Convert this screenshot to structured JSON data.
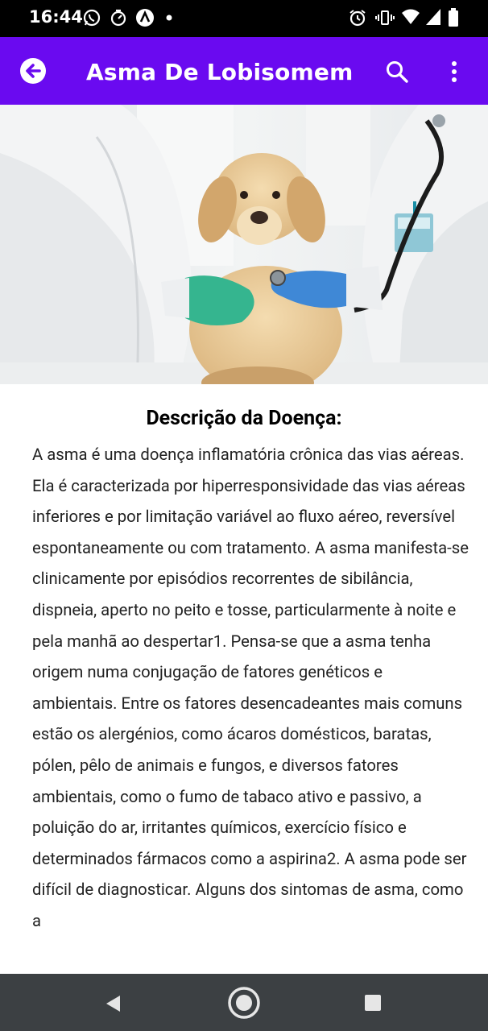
{
  "status_bar": {
    "time": "16:44",
    "left_icons": [
      "whatsapp-icon",
      "activity-icon",
      "app-a-icon",
      "dot-icon"
    ],
    "right_icons": [
      "alarm-icon",
      "vibrate-icon",
      "wifi-icon",
      "signal-icon",
      "battery-icon"
    ]
  },
  "app_bar": {
    "title": "Asma De Lobisomem",
    "background": "#6a0af0"
  },
  "hero": {
    "description_icon": "vet-with-dog-image"
  },
  "content": {
    "heading": "Descrição da Doença:",
    "body": " A asma é uma doença inflamatória crônica das vias aéreas. Ela é caracterizada por hiperresponsividade das vias aéreas inferiores e por limitação variável ao fluxo aéreo, reversível espontaneamente ou com tratamento. A asma manifesta-se clinicamente por episódios recorrentes de sibilância, dispneia, aperto no peito e tosse, particularmente à noite e pela manhã ao despertar1. Pensa-se que a asma tenha origem numa conjugação de fatores genéticos e ambientais. Entre os fatores desencadeantes mais comuns estão os alergénios, como ácaros domésticos, baratas, pólen, pêlo de animais e fungos, e diversos fatores ambientais, como o fumo de tabaco ativo e passivo, a poluição do ar, irritantes químicos, exercício físico e determinados fármacos como a aspirina2. A asma pode ser difícil de diagnosticar. Alguns dos sintomas de asma, como a"
  },
  "nav_bar": {
    "buttons": [
      "back-triangle-icon",
      "home-circle-icon",
      "recents-square-icon"
    ]
  }
}
